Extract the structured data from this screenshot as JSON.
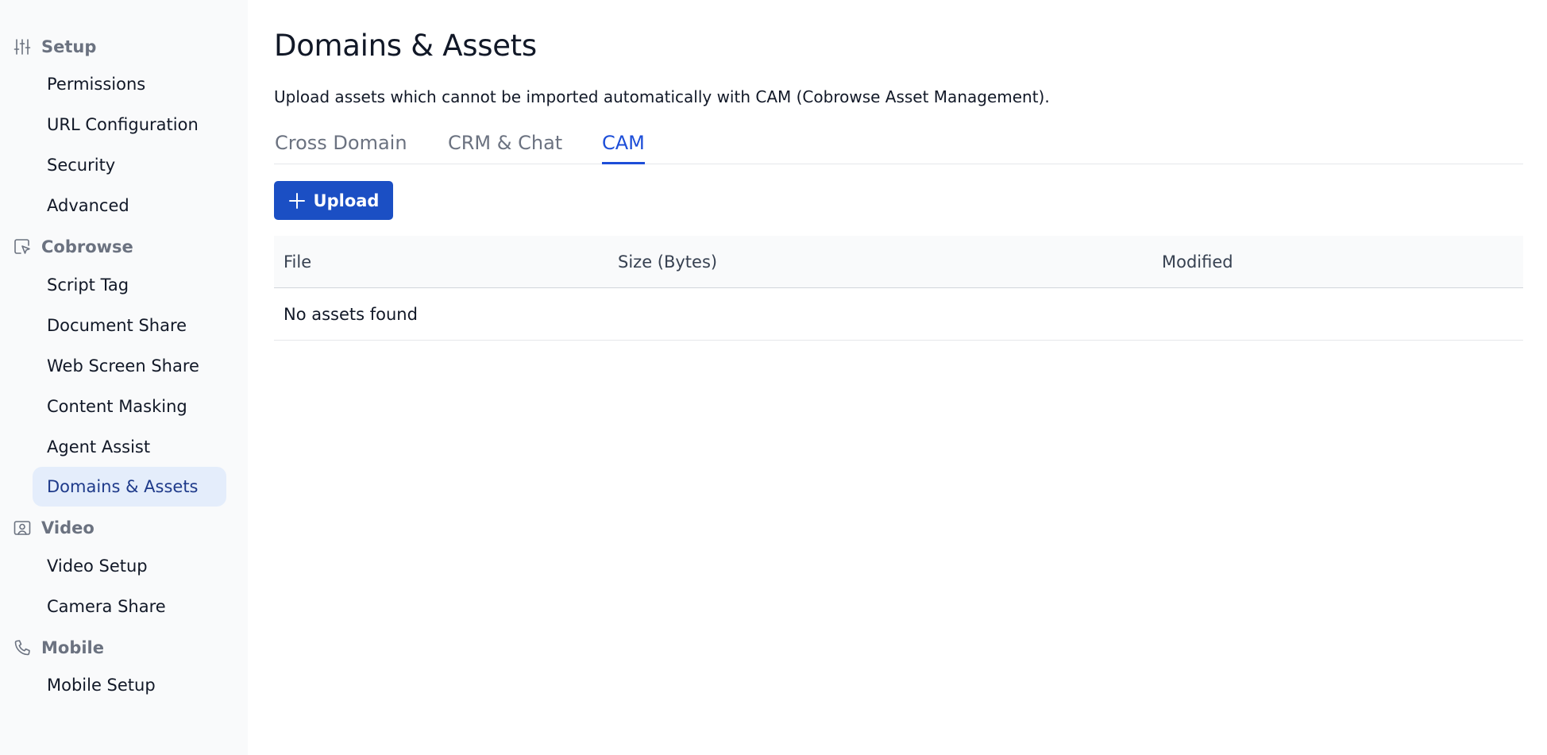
{
  "sidebar": {
    "sections": [
      {
        "label": "Setup",
        "icon": "sliders-icon",
        "items": [
          "Permissions",
          "URL Configuration",
          "Security",
          "Advanced"
        ]
      },
      {
        "label": "Cobrowse",
        "icon": "cursor-window-icon",
        "items": [
          "Script Tag",
          "Document Share",
          "Web Screen Share",
          "Content Masking",
          "Agent Assist",
          "Domains & Assets"
        ]
      },
      {
        "label": "Video",
        "icon": "user-frame-icon",
        "items": [
          "Video Setup",
          "Camera Share"
        ]
      },
      {
        "label": "Mobile",
        "icon": "phone-icon",
        "items": [
          "Mobile Setup"
        ]
      }
    ],
    "active_item": "Domains & Assets"
  },
  "main": {
    "title": "Domains & Assets",
    "description": "Upload assets which cannot be imported automatically with CAM (Cobrowse Asset Management).",
    "tabs": [
      {
        "label": "Cross Domain",
        "active": false
      },
      {
        "label": "CRM & Chat",
        "active": false
      },
      {
        "label": "CAM",
        "active": true
      }
    ],
    "upload_button": {
      "label": "Upload",
      "icon": "plus-icon"
    },
    "table": {
      "columns": [
        "File",
        "Size (Bytes)",
        "Modified"
      ],
      "empty_message": "No assets found"
    }
  },
  "colors": {
    "accent": "#1b4fc4",
    "active_tab": "#1d4ed8",
    "active_nav_bg": "#e4edfb",
    "sidebar_bg": "#f9fafb",
    "muted_text": "#6b7280"
  }
}
